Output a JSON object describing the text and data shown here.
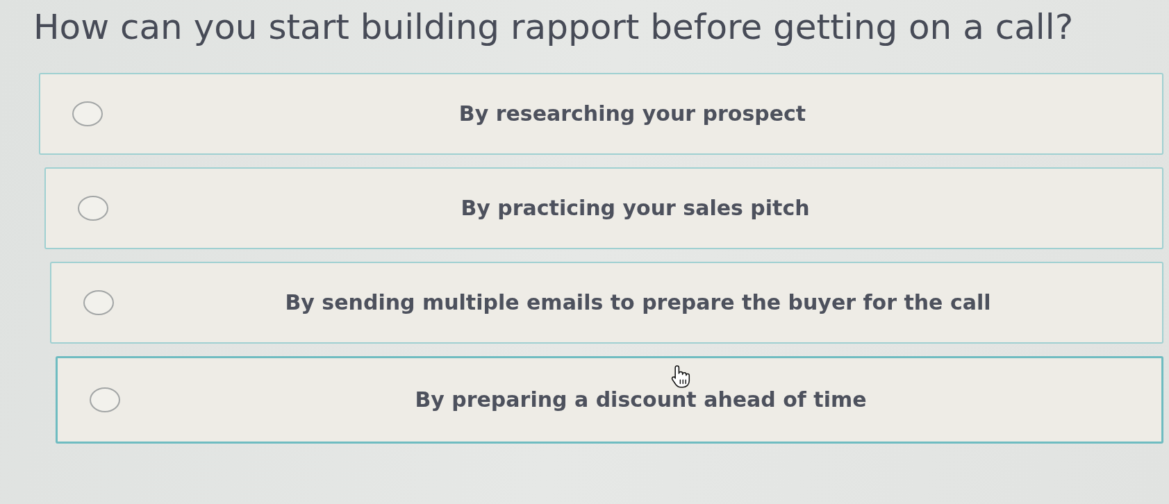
{
  "question": {
    "title": "How can you start building rapport before getting on a call?"
  },
  "options": [
    {
      "label": "By researching your prospect",
      "selected": false,
      "hovered": false
    },
    {
      "label": "By practicing your sales pitch",
      "selected": false,
      "hovered": false
    },
    {
      "label": "By sending multiple emails to prepare the buyer for the call",
      "selected": false,
      "hovered": false
    },
    {
      "label": "By preparing a discount ahead of time",
      "selected": false,
      "hovered": true
    }
  ]
}
